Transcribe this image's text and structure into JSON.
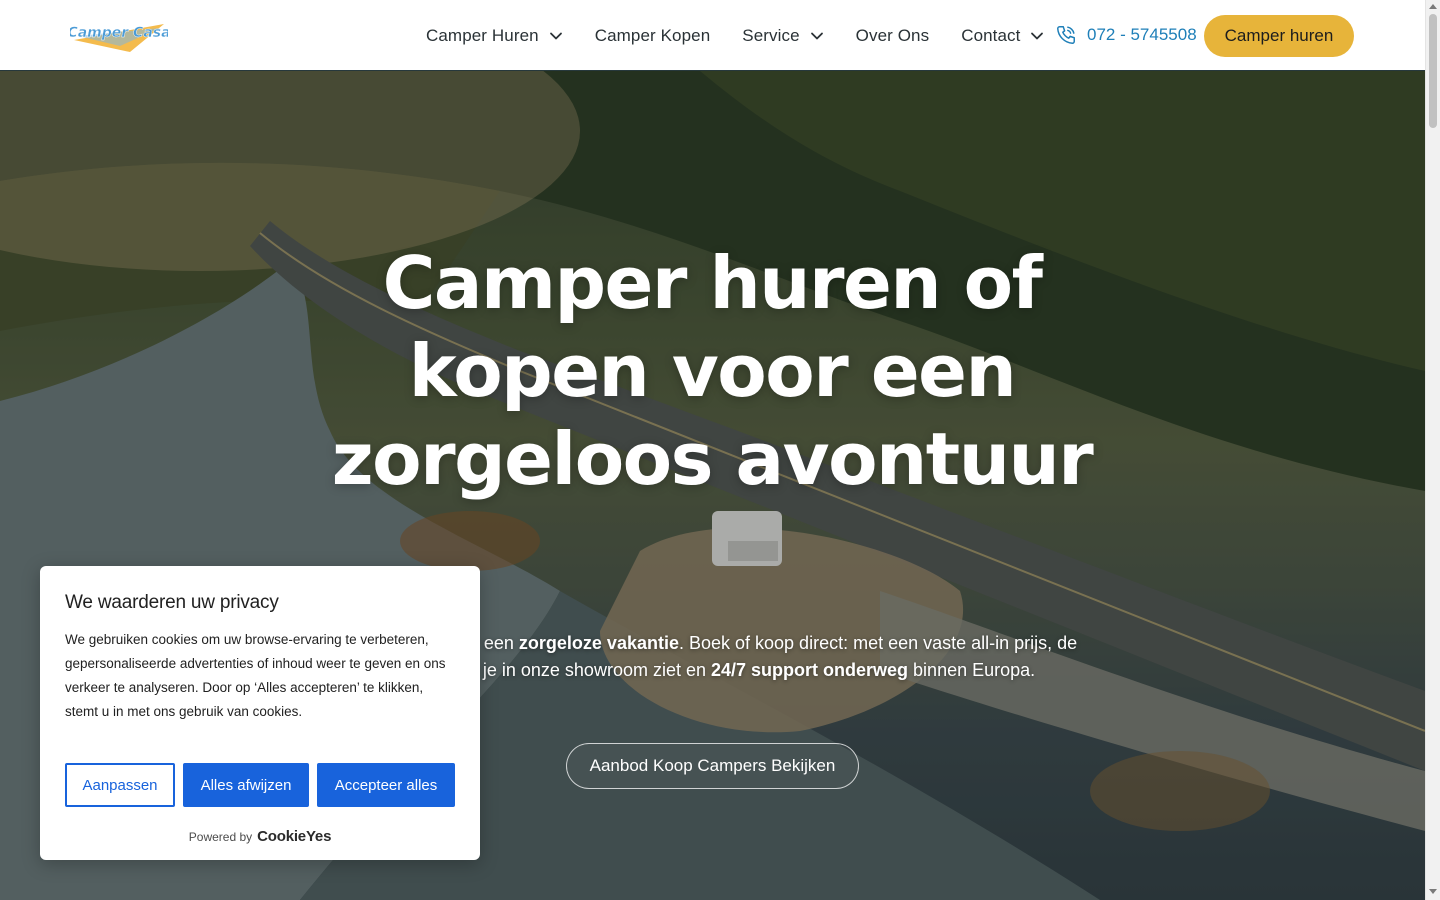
{
  "logo": {
    "text": "Camper Casa"
  },
  "nav": {
    "items": [
      {
        "label": "Camper Huren",
        "has_dropdown": true
      },
      {
        "label": "Camper Kopen",
        "has_dropdown": false
      },
      {
        "label": "Service",
        "has_dropdown": true
      },
      {
        "label": "Over Ons",
        "has_dropdown": false
      },
      {
        "label": "Contact",
        "has_dropdown": true
      }
    ],
    "phone": "072 - 5745508",
    "cta_label": "Camper huren"
  },
  "hero": {
    "title_line1": "Camper huren of",
    "title_line2": "kopen voor een",
    "title_line3": "zorgeloos avontuur",
    "text_part1": "Kies bij ons voor een ",
    "text_bold1": "zorgeloze vakantie",
    "text_part2": ". Boek of koop direct: met een vaste all-in prijs, de camper die je in onze showroom ziet en ",
    "text_bold2": "24/7 support onderweg",
    "text_part3": " binnen Europa.",
    "button_label": "Aanbod Koop Campers Bekijken"
  },
  "cookie_banner": {
    "title": "We waarderen uw privacy",
    "text": "We gebruiken cookies om uw browse-ervaring te verbeteren, gepersonaliseerde advertenties of inhoud weer te geven en ons verkeer te analyseren. Door op ‘Alles accepteren’ te klikken, stemt u in met ons gebruik van cookies.",
    "customize_label": "Aanpassen",
    "reject_label": "Alles afwijzen",
    "accept_label": "Accepteer alles",
    "powered_by": "Powered by",
    "powered_brand": "CookieYes"
  },
  "colors": {
    "accent": "#e7b43a",
    "phone": "#1e7fb8",
    "cookie_button": "#1863dc",
    "nav_text": "#2a3236"
  },
  "icons": [
    "chevron-down-icon",
    "phone-icon",
    "logo-icon"
  ]
}
